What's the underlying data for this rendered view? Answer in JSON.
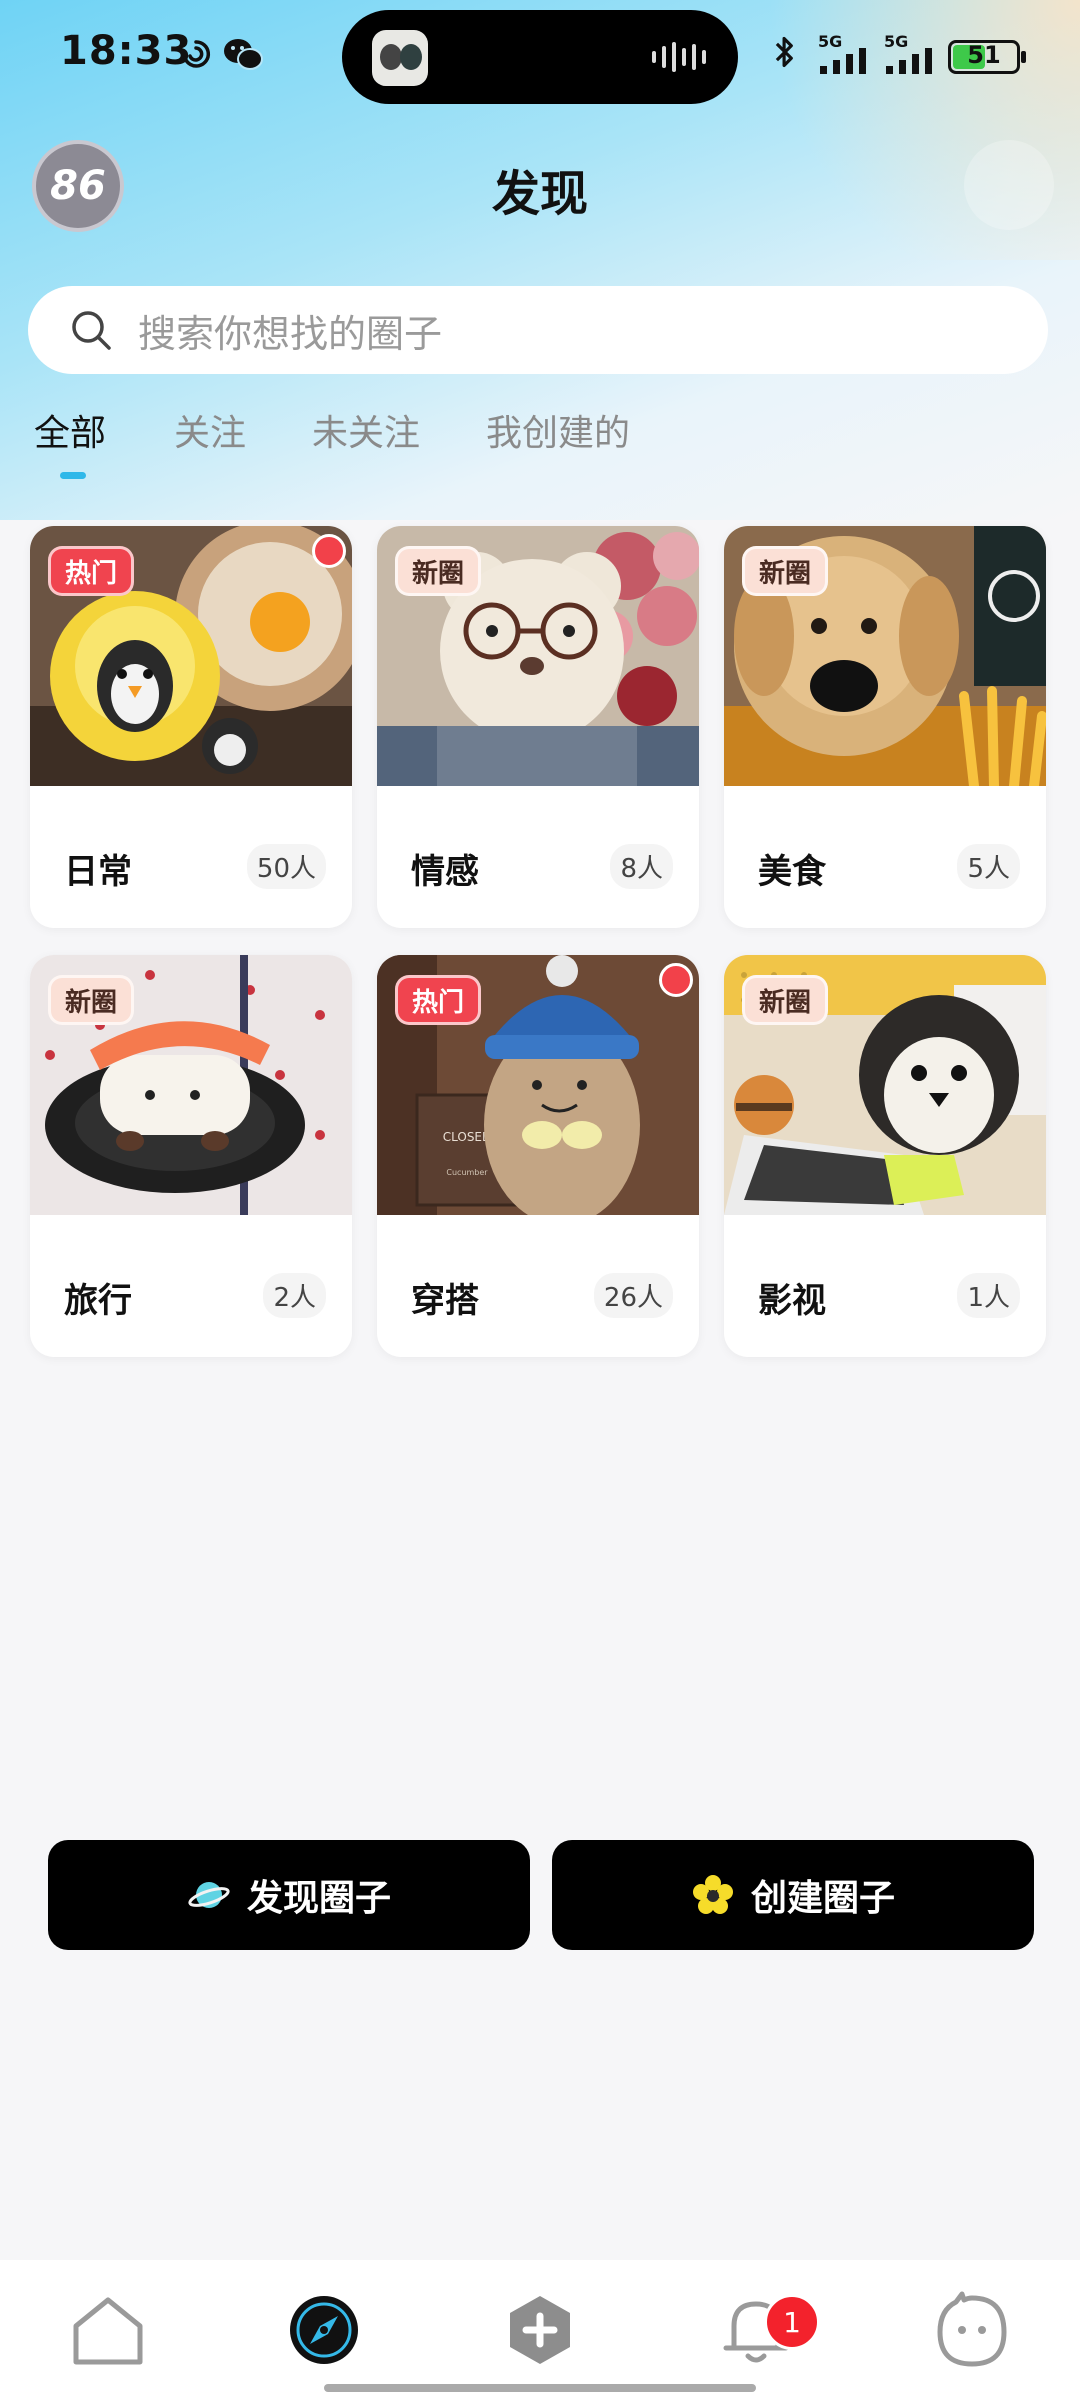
{
  "status_bar": {
    "time": "18:33",
    "network_1": "5G",
    "network_2": "5G",
    "battery": "51",
    "battery_level_percent": 51
  },
  "header": {
    "avatar_text": "86",
    "title": "发现"
  },
  "search": {
    "placeholder": "搜索你想找的圈子"
  },
  "tabs": [
    {
      "label": "全部",
      "active": true
    },
    {
      "label": "关注",
      "active": false
    },
    {
      "label": "未关注",
      "active": false
    },
    {
      "label": "我创建的",
      "active": false
    }
  ],
  "circles": [
    {
      "name": "日常",
      "count": "50人",
      "badge": "热门",
      "badge_type": "hot",
      "has_dot": true
    },
    {
      "name": "情感",
      "count": "8人",
      "badge": "新圈",
      "badge_type": "new",
      "has_dot": false
    },
    {
      "name": "美食",
      "count": "5人",
      "badge": "新圈",
      "badge_type": "new",
      "has_dot": false
    },
    {
      "name": "旅行",
      "count": "2人",
      "badge": "新圈",
      "badge_type": "new",
      "has_dot": false
    },
    {
      "name": "穿搭",
      "count": "26人",
      "badge": "热门",
      "badge_type": "hot",
      "has_dot": true
    },
    {
      "name": "影视",
      "count": "1人",
      "badge": "新圈",
      "badge_type": "new",
      "has_dot": false
    }
  ],
  "image_text": {
    "closed_sign": "CLOSED",
    "closed_sign_sub": "Cucumber"
  },
  "actions": {
    "discover_label": "发现圈子",
    "create_label": "创建圈子"
  },
  "bottom_nav": {
    "items": [
      "home-icon",
      "discover-compass-icon",
      "add-icon",
      "notification-bell-icon",
      "profile-face-icon"
    ],
    "notification_badge": "1",
    "active": "discover-compass-icon"
  },
  "colors": {
    "accent": "#2fb8e9",
    "hot_badge": "#f0444f",
    "new_badge": "#fbe0d6",
    "button_bg": "#000000"
  }
}
